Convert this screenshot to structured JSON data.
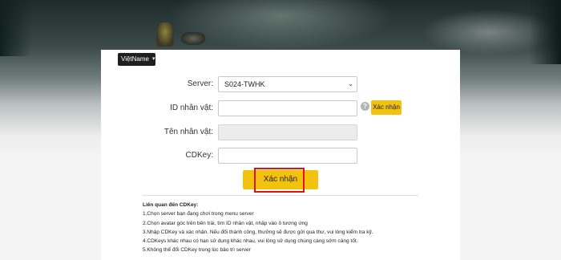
{
  "language_selector": {
    "label": "ViệtName",
    "icon": "chevron-down-icon"
  },
  "form": {
    "server_label": "Server:",
    "server_value": "S024-TWHK",
    "character_id_label": "ID nhân vật:",
    "character_id_value": "",
    "verify_button": "Xác nhận",
    "character_name_label": "Tên nhân vật:",
    "character_name_value": "",
    "cdkey_label": "CDKey:",
    "cdkey_value": "",
    "submit_button": "Xác nhận"
  },
  "notes": {
    "title": "Liên quan đến CDKey:",
    "items": [
      "1.Chọn server bạn đang chơi trong menu server",
      "2.Chọn avatar góc trên bên trái, tìm ID nhân vật, nhập vào ô tương ứng",
      "3.Nhập CDKey và xác nhận. Nếu đổi thành công, thưởng sẽ được gửi qua thư, vui lòng kiểm tra kỹ.",
      "4.CDKeys khác nhau có hạn sử dụng khác nhau, vui lòng sử dụng chúng càng sớm càng tốt.",
      "5.Không thể đổi CDKey trong lúc bảo trì server"
    ]
  },
  "colors": {
    "accent": "#f2c20f",
    "highlight": "#e0140e"
  }
}
